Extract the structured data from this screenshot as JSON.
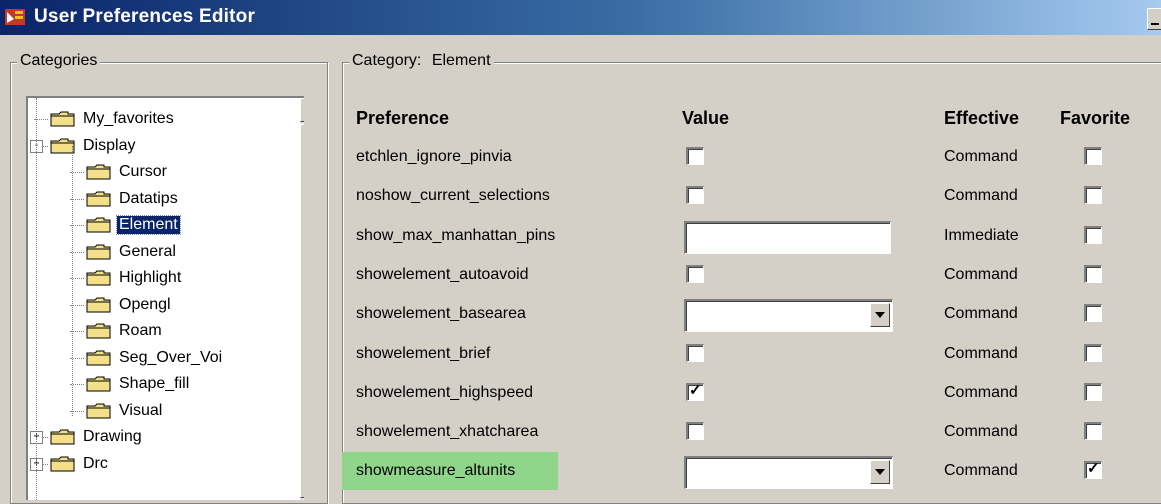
{
  "window": {
    "title": "User Preferences Editor"
  },
  "categories_panel": {
    "label": "Categories",
    "tree": [
      {
        "label": "My_favorites",
        "level": 0,
        "expander": "none",
        "selected": false
      },
      {
        "label": "Display",
        "level": 0,
        "expander": "-",
        "selected": false
      },
      {
        "label": "Cursor",
        "level": 1,
        "expander": "none",
        "selected": false
      },
      {
        "label": "Datatips",
        "level": 1,
        "expander": "none",
        "selected": false
      },
      {
        "label": "Element",
        "level": 1,
        "expander": "none",
        "selected": true
      },
      {
        "label": "General",
        "level": 1,
        "expander": "none",
        "selected": false
      },
      {
        "label": "Highlight",
        "level": 1,
        "expander": "none",
        "selected": false
      },
      {
        "label": "Opengl",
        "level": 1,
        "expander": "none",
        "selected": false
      },
      {
        "label": "Roam",
        "level": 1,
        "expander": "none",
        "selected": false
      },
      {
        "label": "Seg_Over_Voi",
        "level": 1,
        "expander": "none",
        "selected": false
      },
      {
        "label": "Shape_fill",
        "level": 1,
        "expander": "none",
        "selected": false
      },
      {
        "label": "Visual",
        "level": 1,
        "expander": "none",
        "selected": false
      },
      {
        "label": "Drawing",
        "level": 0,
        "expander": "+",
        "selected": false
      },
      {
        "label": "Drc",
        "level": 0,
        "expander": "+",
        "selected": false
      }
    ]
  },
  "category_panel": {
    "label_prefix": "Category:",
    "category_name": "Element",
    "headers": {
      "preference": "Preference",
      "value": "Value",
      "effective": "Effective",
      "favorite": "Favorite"
    },
    "rows": [
      {
        "name": "etchlen_ignore_pinvia",
        "control": "checkbox",
        "checked": false,
        "effective": "Command",
        "favorite": false,
        "highlighted": false
      },
      {
        "name": "noshow_current_selections",
        "control": "checkbox",
        "checked": false,
        "effective": "Command",
        "favorite": false,
        "highlighted": false
      },
      {
        "name": "show_max_manhattan_pins",
        "control": "textbox",
        "value": "",
        "effective": "Immediate",
        "favorite": false,
        "highlighted": false
      },
      {
        "name": "showelement_autoavoid",
        "control": "checkbox",
        "checked": false,
        "effective": "Command",
        "favorite": false,
        "highlighted": false
      },
      {
        "name": "showelement_basearea",
        "control": "combo",
        "value": "",
        "effective": "Command",
        "favorite": false,
        "highlighted": false
      },
      {
        "name": "showelement_brief",
        "control": "checkbox",
        "checked": false,
        "effective": "Command",
        "favorite": false,
        "highlighted": false
      },
      {
        "name": "showelement_highspeed",
        "control": "checkbox",
        "checked": true,
        "effective": "Command",
        "favorite": false,
        "highlighted": false
      },
      {
        "name": "showelement_xhatcharea",
        "control": "checkbox",
        "checked": false,
        "effective": "Command",
        "favorite": false,
        "highlighted": false
      },
      {
        "name": "showmeasure_altunits",
        "control": "combo",
        "value": "",
        "effective": "Command",
        "favorite": true,
        "highlighted": true
      }
    ],
    "check_glyph": "✓"
  },
  "colors": {
    "title_start": "#0a246a",
    "title_end": "#a6caf0",
    "highlight": "#8fd58a",
    "selection": "#0a246a",
    "folder": "#f5e08a"
  }
}
